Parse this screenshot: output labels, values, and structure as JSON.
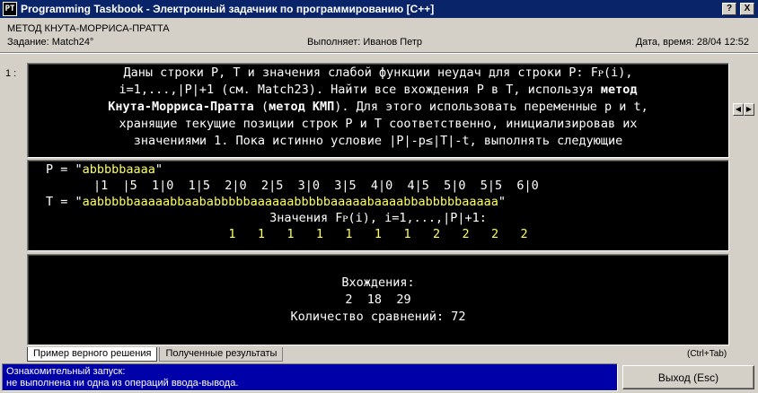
{
  "window": {
    "icon_text": "PT",
    "title": "Programming Taskbook - Электронный задачник по программированию [C++]",
    "help_label": "?",
    "close_label": "X"
  },
  "header": {
    "method_title": "МЕТОД КНУТА-МОРРИСА-ПРАТТА",
    "task_label": "Задание: Match24°",
    "executor_label": "Выполняет: Иванов Петр",
    "datetime_label": "Дата, время: 28/04 12:52"
  },
  "pane_index": "1 :",
  "task": {
    "lines": [
      "Даны строки P, T и значения слабой функции неудач для строки P: Fᴘ(i),",
      "i=1,...,|P|+1 (см. Match23). Найти все вхождения P в T, используя ",
      " (метод КМП). Для этого использовать переменные p и t,",
      "хранящие текущие позиции строк P и T соответственно, инициализировав их",
      "значениями 1. Пока истинно условие |P|-p≤|T|-t, выполнять следующие"
    ],
    "bold_method": "метод",
    "bold_kmp": "Кнута-Морриса-Пратта",
    "bold_kmp2": "метод КМП"
  },
  "data": {
    "p_prefix": "P = \"",
    "p_value": "abbbbbaaaa",
    "p_suffix": "\"",
    "ruler": "|1  |5  1|0  1|5  2|0  2|5  3|0  3|5  4|0  4|5  5|0  5|5  6|0",
    "t_prefix": "T = \"",
    "t_value": "aabbbbbaaaaabbaababbbbbaaaaaabbbbbaaaaabaaaabbabbbbbaaaaa",
    "t_suffix": "\"",
    "f_label": "Значения Fᴘ(i), i=1,...,|P|+1:",
    "f_values": "1   1   1   1   1   1   1   2   2   2   2"
  },
  "result": {
    "occurrences_label": "Вхождения:",
    "occurrences_values": "2  18  29",
    "comparisons_label": "Количество сравнений: 72"
  },
  "tabs": {
    "sample": "Пример верного решения",
    "results": "Полученные результаты",
    "hotkey": "(Ctrl+Tab)"
  },
  "status": {
    "line1": "Ознакомительный запуск:",
    "line2": " не выполнена ни одна из операций ввода-вывода."
  },
  "exit_label": "Выход (Esc)"
}
